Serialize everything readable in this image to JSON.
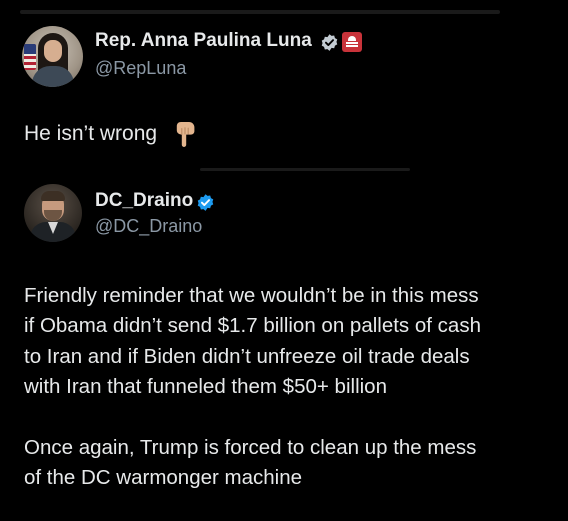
{
  "main_post": {
    "author_name": "Rep. Anna Paulina Luna",
    "author_handle": "@RepLuna",
    "verified_badge": "verified-icon",
    "affiliation_badge": "government-building-icon",
    "text": "He isn’t wrong",
    "emoji": "pointing-down-hand-icon"
  },
  "quoted_post": {
    "author_name": "DC_Draino",
    "author_handle": "@DC_Draino",
    "verified_badge": "verified-icon",
    "lines": [
      "Friendly reminder that we wouldn’t be in this mess",
      "if Obama didn’t send $1.7 billion on pallets of cash",
      "to Iran and if Biden didn’t unfreeze oil trade deals",
      "with Iran that funneled them $50+ billion",
      "Once again, Trump is forced to clean up the mess",
      "of the DC warmonger machine"
    ]
  },
  "colors": {
    "background": "#000000",
    "primary_text": "#e7e9ea",
    "secondary_text": "#8b98a5",
    "verified_blue": "#1d9bf0",
    "gov_badge_red": "#c8333a"
  }
}
